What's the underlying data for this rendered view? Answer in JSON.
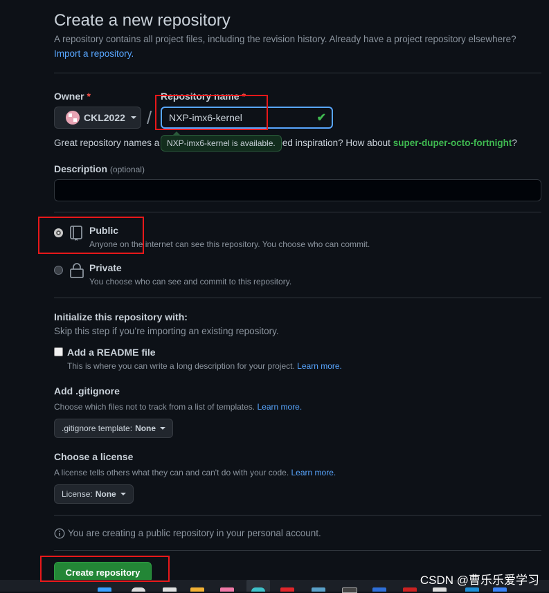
{
  "header": {
    "title": "Create a new repository",
    "subtitle": "A repository contains all project files, including the revision history. Already have a project repository elsewhere?",
    "import_link": "Import a repository."
  },
  "owner": {
    "label": "Owner",
    "required_mark": "*",
    "value": "CKL2022"
  },
  "separator": "/",
  "repo_name": {
    "label": "Repository name",
    "required_mark": "*",
    "value": "NXP-imx6-kernel",
    "tooltip": "NXP-imx6-kernel is available.",
    "valid": true
  },
  "hint": {
    "prefix": "Great repository names a",
    "middle": "eed inspiration? How about ",
    "suggestion": "super-duper-octo-fortnight",
    "suffix": "?"
  },
  "description": {
    "label": "Description",
    "optional": "(optional)",
    "value": ""
  },
  "visibility": {
    "selected": "public",
    "public": {
      "title": "Public",
      "desc": "Anyone on the internet can see this repository. You choose who can commit."
    },
    "private": {
      "title": "Private",
      "desc": "You choose who can see and commit to this repository."
    }
  },
  "init": {
    "title": "Initialize this repository with:",
    "desc": "Skip this step if you’re importing an existing repository.",
    "readme": {
      "label": "Add a README file",
      "desc": "This is where you can write a long description for your project.",
      "learn_more": "Learn more.",
      "checked": false
    }
  },
  "gitignore": {
    "title": "Add .gitignore",
    "desc": "Choose which files not to track from a list of templates.",
    "learn_more": "Learn more.",
    "button_prefix": ".gitignore template:",
    "button_value": "None"
  },
  "license": {
    "title": "Choose a license",
    "desc": "A license tells others what they can and can't do with your code.",
    "learn_more": "Learn more.",
    "button_prefix": "License:",
    "button_value": "None"
  },
  "notice": "You are creating a public repository in your personal account.",
  "submit_label": "Create repository",
  "watermark": "CSDN @曹乐乐爱学习",
  "colors": {
    "background": "#0d1117",
    "accent": "#58a6ff",
    "success": "#3fb950",
    "primary_button": "#238636",
    "annotation": "#e8181a"
  }
}
